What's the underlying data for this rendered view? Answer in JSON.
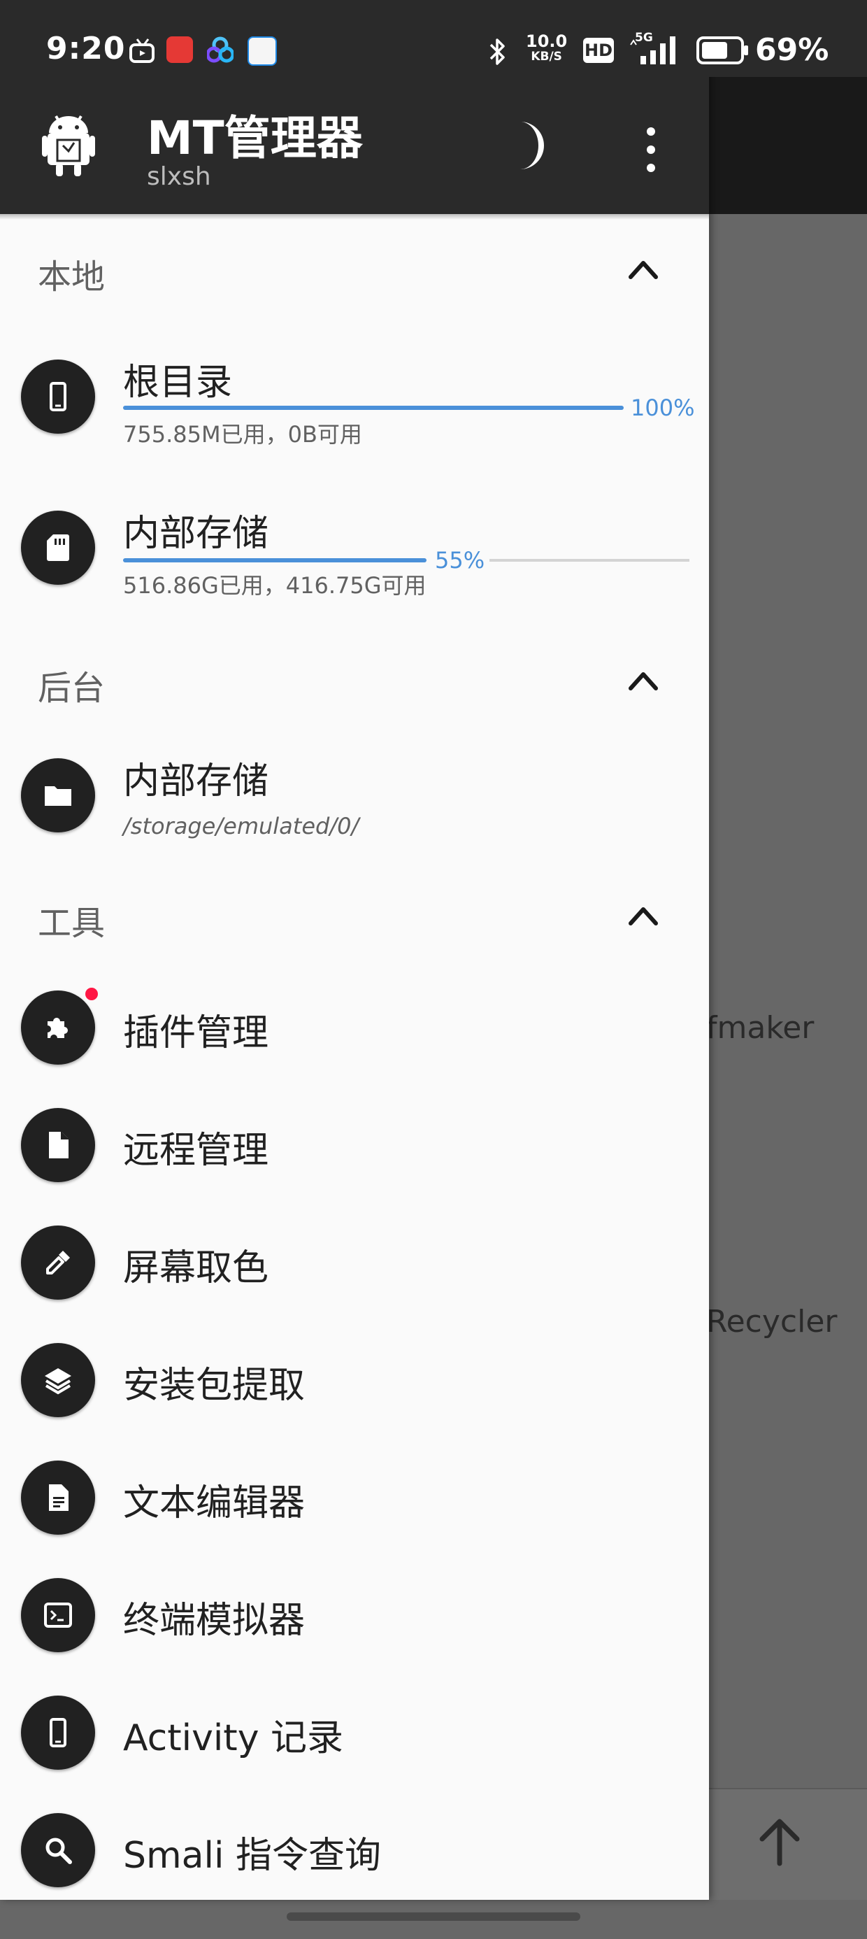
{
  "status_bar": {
    "time": "9:20",
    "net_speed_value": "10.0",
    "net_speed_unit": "KB/S",
    "hd_label": "HD",
    "network_type": "5G",
    "battery_percent": "69%"
  },
  "header": {
    "title": "MT管理器",
    "subtitle": "slxsh"
  },
  "sections": {
    "local": {
      "title": "本地",
      "items": [
        {
          "label": "根目录",
          "usage": "755.85M已用，0B可用",
          "percent_label": "100%",
          "percent": 100
        },
        {
          "label": "内部存储",
          "usage": "516.86G已用，416.75G可用",
          "percent_label": "55%",
          "percent": 55
        }
      ]
    },
    "background": {
      "title": "后台",
      "items": [
        {
          "label": "内部存储",
          "path": "/storage/emulated/0/"
        }
      ]
    },
    "tools": {
      "title": "工具",
      "items": [
        {
          "label": "插件管理",
          "icon": "puzzle-icon"
        },
        {
          "label": "远程管理",
          "icon": "file-icon"
        },
        {
          "label": "屏幕取色",
          "icon": "eyedropper-icon"
        },
        {
          "label": "安装包提取",
          "icon": "layers-icon"
        },
        {
          "label": "文本编辑器",
          "icon": "document-icon"
        },
        {
          "label": "终端模拟器",
          "icon": "terminal-icon"
        },
        {
          "label": "Activity 记录",
          "icon": "phone-icon"
        },
        {
          "label": "Smali 指令查询",
          "icon": "search-icon"
        }
      ]
    }
  },
  "background_app": {
    "text_1": "fmaker",
    "text_2": "Recycler"
  },
  "colors": {
    "accent": "#4a90d9",
    "header_bg": "#2a2a2a",
    "icon_bg": "#212121",
    "badge": "#ff1744"
  }
}
